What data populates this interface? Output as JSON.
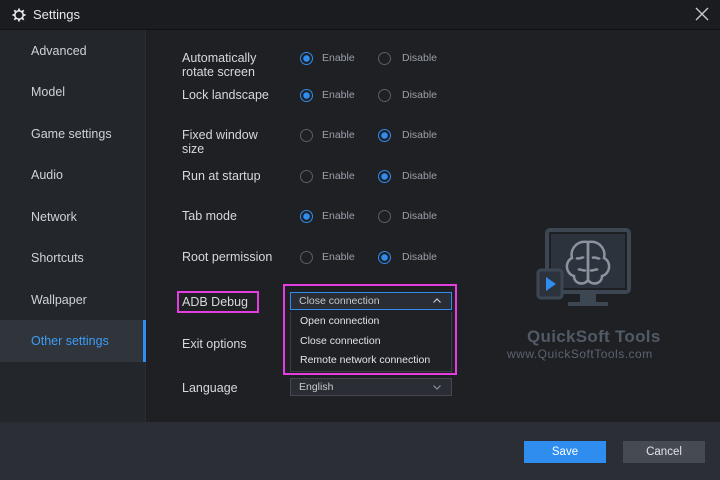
{
  "window": {
    "title": "Settings",
    "icon": "gear-icon",
    "close_icon": "close-icon"
  },
  "sidebar": {
    "items": [
      {
        "label": "Advanced"
      },
      {
        "label": "Model"
      },
      {
        "label": "Game settings"
      },
      {
        "label": "Audio"
      },
      {
        "label": "Network"
      },
      {
        "label": "Shortcuts"
      },
      {
        "label": "Wallpaper"
      },
      {
        "label": "Other settings",
        "active": true
      }
    ]
  },
  "settings": {
    "enable_label": "Enable",
    "disable_label": "Disable",
    "rows": [
      {
        "label_line1": "Automatically",
        "label_line2": "rotate screen",
        "selected": "Enable"
      },
      {
        "label_line1": "Lock landscape",
        "label_line2": "",
        "selected": "Enable"
      },
      {
        "label_line1": "Fixed window",
        "label_line2": "size",
        "selected": "Disable"
      },
      {
        "label_line1": "Run at startup",
        "label_line2": "",
        "selected": "Disable"
      },
      {
        "label_line1": "Tab mode",
        "label_line2": "",
        "selected": "Enable"
      },
      {
        "label_line1": "Root permission",
        "label_line2": "",
        "selected": "Disable"
      }
    ],
    "adb_debug": {
      "label": "ADB Debug",
      "value": "Close connection",
      "options": [
        "Open connection",
        "Close connection",
        "Remote network connection"
      ]
    },
    "exit_options": {
      "label": "Exit options"
    },
    "language": {
      "label": "Language",
      "value": "English"
    }
  },
  "watermark": {
    "brand": "QuickSoft Tools",
    "url": "www.QuickSoftTools.com"
  },
  "footer": {
    "save_label": "Save",
    "cancel_label": "Cancel"
  },
  "colors": {
    "accent": "#2f8df0",
    "highlight": "#e43ee1",
    "background": "#1e2024"
  }
}
